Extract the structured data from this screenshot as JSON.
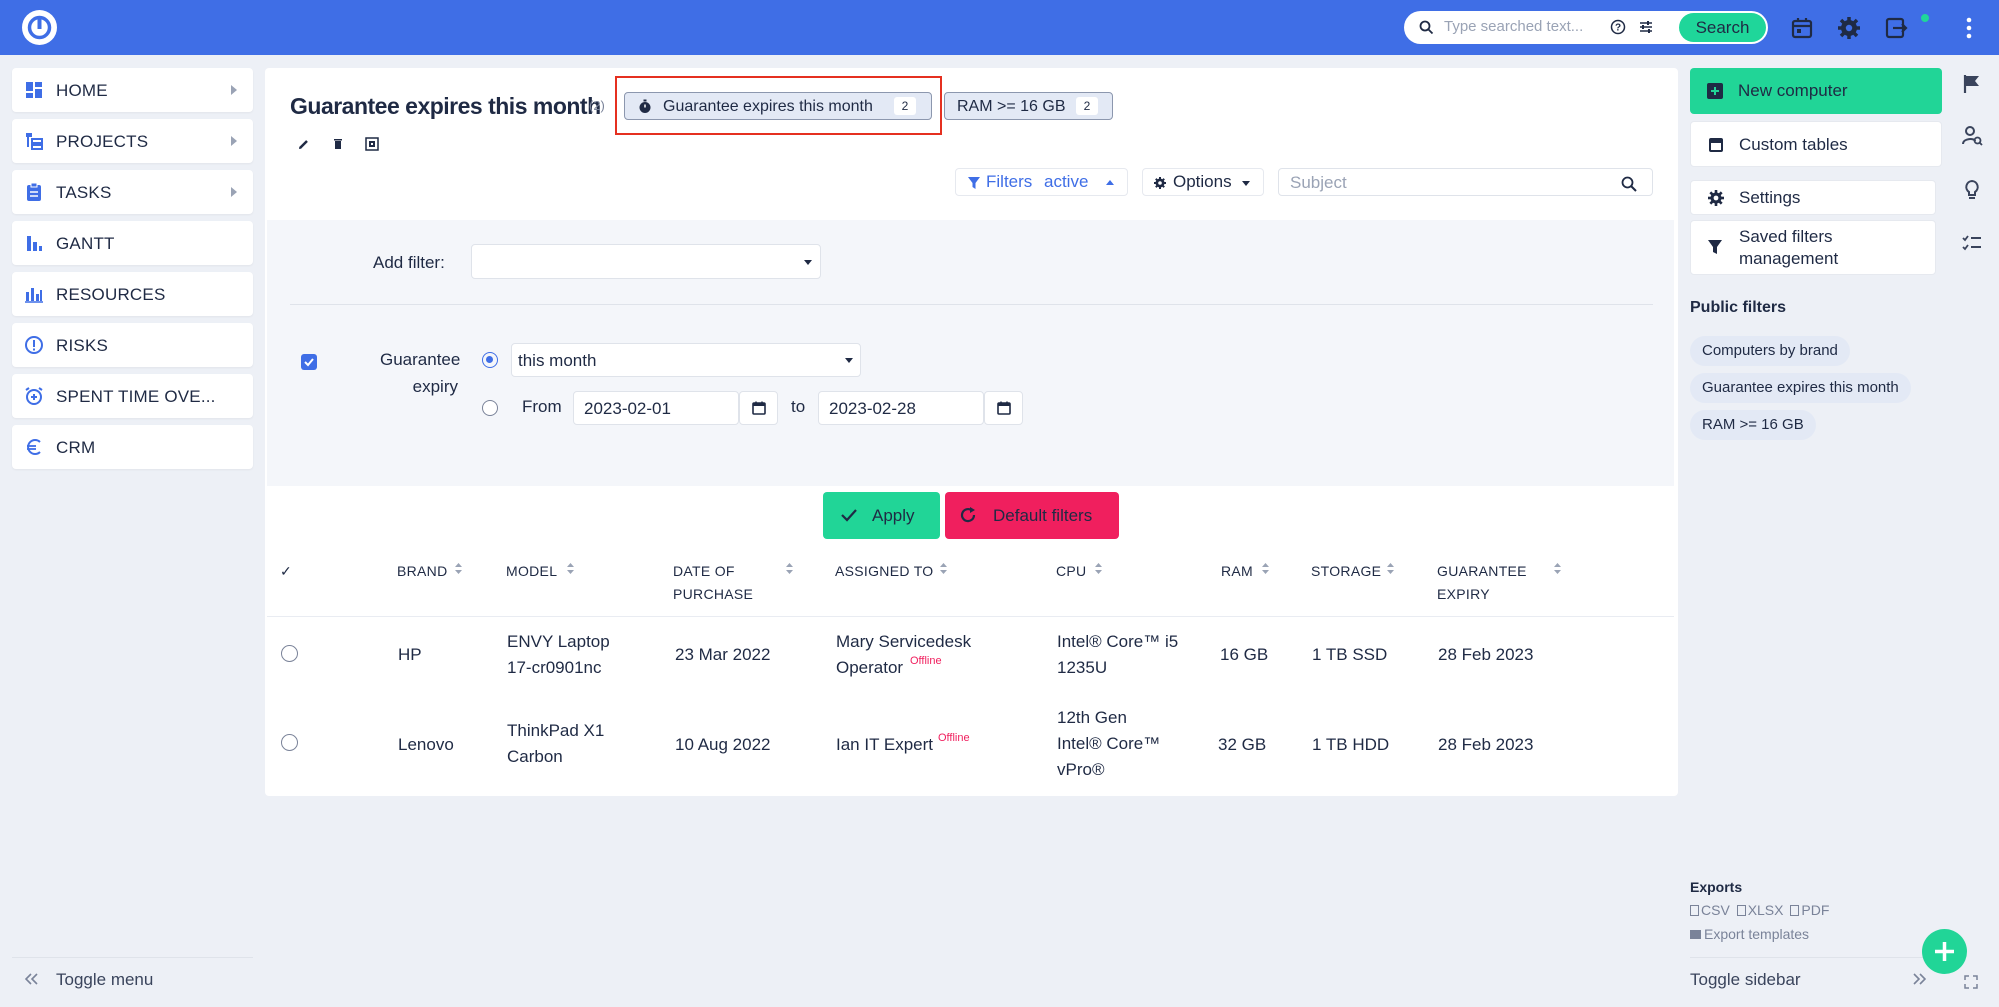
{
  "topbar": {
    "search_placeholder": "Type searched text...",
    "search_button": "Search"
  },
  "nav": {
    "items": [
      {
        "label": "HOME",
        "icon": "dashboard-icon",
        "has_arrow": true
      },
      {
        "label": "PROJECTS",
        "icon": "projects-tree-icon",
        "has_arrow": true
      },
      {
        "label": "TASKS",
        "icon": "clipboard-icon",
        "has_arrow": true
      },
      {
        "label": "GANTT",
        "icon": "bar-chart-icon",
        "has_arrow": false
      },
      {
        "label": "RESOURCES",
        "icon": "resources-chart-icon",
        "has_arrow": false
      },
      {
        "label": "RISKS",
        "icon": "alert-circle-icon",
        "has_arrow": false
      },
      {
        "label": "SPENT TIME OVE...",
        "icon": "alarm-clock-icon",
        "has_arrow": false
      },
      {
        "label": "CRM",
        "icon": "euro-icon",
        "has_arrow": false
      }
    ],
    "toggle_menu": "Toggle menu"
  },
  "main": {
    "title": "Guarantee expires this month",
    "title_count": "(2)",
    "chips": [
      {
        "label": "Guarantee expires this month",
        "count": "2",
        "active": true
      },
      {
        "label": "RAM >= 16 GB",
        "count": "2",
        "active": false
      }
    ],
    "filters_label": "Filters",
    "filters_state": "active",
    "options_label": "Options",
    "subject_placeholder": "Subject"
  },
  "filter_panel": {
    "add_filter_label": "Add filter:",
    "add_filter_value": "",
    "filter_name_line1": "Guarantee",
    "filter_name_line2": "expiry",
    "period_value": "this month",
    "from_label": "From",
    "from_value": "2023-02-01",
    "to_label": "to",
    "to_value": "2023-02-28",
    "apply_label": "Apply",
    "default_label": "Default filters"
  },
  "table": {
    "check_header": "✓",
    "columns": [
      "BRAND",
      "MODEL",
      "DATE OF PURCHASE",
      "ASSIGNED TO",
      "CPU",
      "RAM",
      "STORAGE",
      "GUARANTEE EXPIRY"
    ],
    "rows": [
      {
        "brand": "HP",
        "model_1": "ENVY Laptop",
        "model_2": "17-cr0901nc",
        "date": "23 Mar 2022",
        "assigned_1": "Mary Servicedesk",
        "assigned_2": "Operator",
        "status": "Offline",
        "cpu_1": "Intel® Core™ i5",
        "cpu_2": "1235U",
        "cpu_3": "",
        "ram": "16 GB",
        "storage": "1 TB SSD",
        "expiry": "28 Feb 2023"
      },
      {
        "brand": "Lenovo",
        "model_1": "ThinkPad X1",
        "model_2": "Carbon",
        "date": "10 Aug 2022",
        "assigned_1": "Ian IT Expert",
        "assigned_2": "",
        "status": "Offline",
        "cpu_1": "12th Gen",
        "cpu_2": "Intel® Core™",
        "cpu_3": "vPro®",
        "ram": "32 GB",
        "storage": "1 TB HDD",
        "expiry": "28 Feb 2023"
      }
    ]
  },
  "sidebar": {
    "new_computer": "New computer",
    "custom_tables": "Custom tables",
    "settings": "Settings",
    "saved_filters_1": "Saved filters",
    "saved_filters_2": "management",
    "public_filters_head": "Public filters",
    "public_filters": [
      "Computers by brand",
      "Guarantee expires this month",
      "RAM >= 16 GB"
    ],
    "exports_head": "Exports",
    "export_csv": "CSV",
    "export_xlsx": "XLSX",
    "export_pdf": "PDF",
    "export_templates": "Export templates",
    "toggle_sidebar": "Toggle sidebar"
  },
  "colors": {
    "topbar": "#3f6ee6",
    "accent_green": "#21d597",
    "accent_red": "#f01f5e",
    "highlight": "#e53020"
  }
}
